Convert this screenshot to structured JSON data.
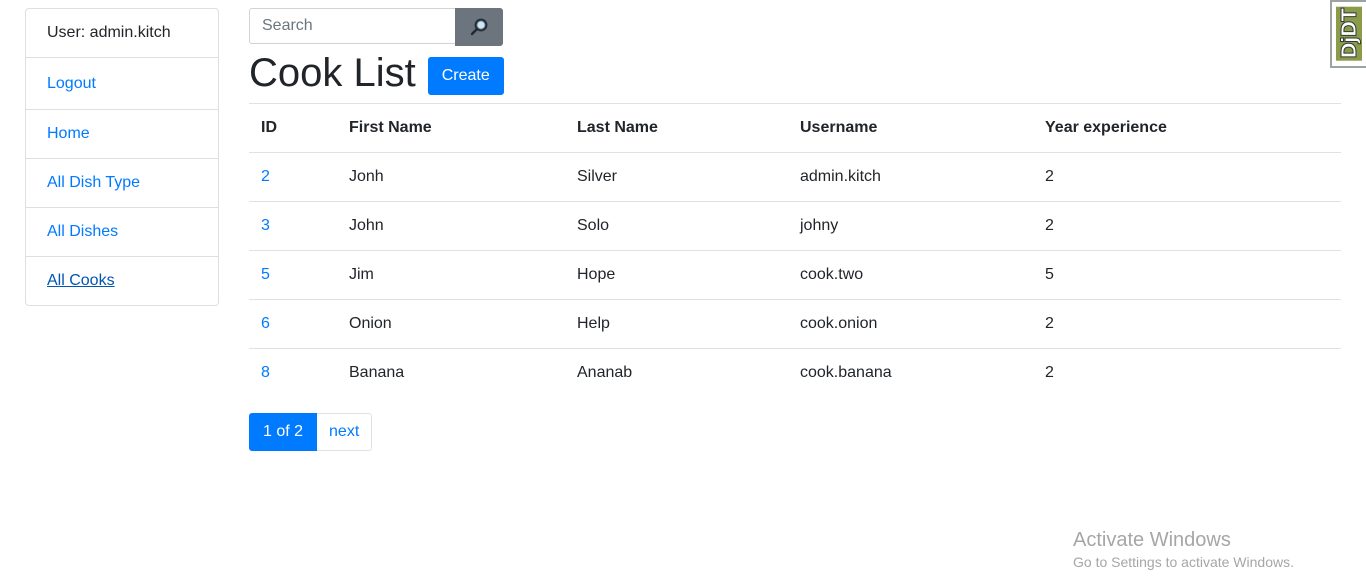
{
  "sidebar": {
    "user": "User: admin.kitch",
    "items": [
      {
        "label": "Logout"
      },
      {
        "label": "Home"
      },
      {
        "label": "All Dish Type"
      },
      {
        "label": "All Dishes"
      },
      {
        "label": "All Cooks"
      }
    ]
  },
  "search": {
    "placeholder": "Search",
    "value": "",
    "icon": "search-icon"
  },
  "page_title": "Cook List",
  "create_label": "Create",
  "table": {
    "headers": [
      "ID",
      "First Name",
      "Last Name",
      "Username",
      "Year experience"
    ],
    "rows": [
      [
        "2",
        "Jonh",
        "Silver",
        "admin.kitch",
        "2"
      ],
      [
        "3",
        "John",
        "Solo",
        "johny",
        "2"
      ],
      [
        "5",
        "Jim",
        "Hope",
        "cook.two",
        "5"
      ],
      [
        "6",
        "Onion",
        "Help",
        "cook.onion",
        "2"
      ],
      [
        "8",
        "Banana",
        "Ananab",
        "cook.banana",
        "2"
      ]
    ]
  },
  "pagination": {
    "current": "1 of 2",
    "next": "next"
  },
  "toolbar_handle": "DjDT",
  "watermark": {
    "line1": "Activate Windows",
    "line2": "Go to Settings to activate Windows."
  },
  "colors": {
    "primary": "#007bff",
    "secondary": "#6c757d",
    "text": "#212529"
  }
}
